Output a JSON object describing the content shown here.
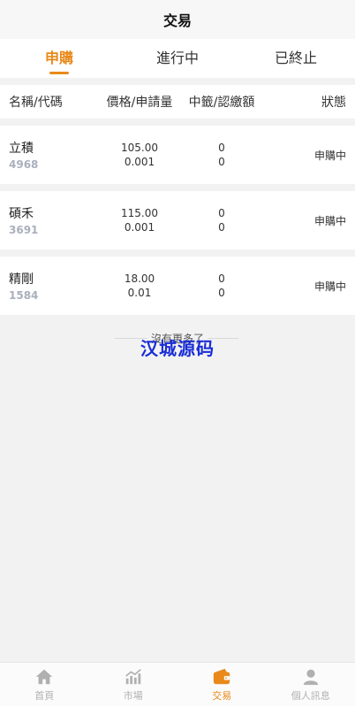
{
  "header": {
    "title": "交易"
  },
  "tabs": [
    {
      "label": "申購",
      "active": true
    },
    {
      "label": "進行中",
      "active": false
    },
    {
      "label": "已終止",
      "active": false
    }
  ],
  "columns": {
    "name": "名稱/代碼",
    "price": "價格/申請量",
    "won": "中籤/認繳額",
    "status": "狀態"
  },
  "rows": [
    {
      "name": "立積",
      "code": "4968",
      "price": "105.00",
      "qty": "0.001",
      "won": "0",
      "paid": "0",
      "status": "申購中"
    },
    {
      "name": "碩禾",
      "code": "3691",
      "price": "115.00",
      "qty": "0.001",
      "won": "0",
      "paid": "0",
      "status": "申購中"
    },
    {
      "name": "精剛",
      "code": "1584",
      "price": "18.00",
      "qty": "0.01",
      "won": "0",
      "paid": "0",
      "status": "申購中"
    }
  ],
  "footer_text": "沒有更多了",
  "watermark": "汉城源码",
  "colors": {
    "accent": "#e8891a",
    "inactive": "#b0b0b0",
    "watermark": "#1a2dd8"
  },
  "tabbar": [
    {
      "label": "首頁",
      "icon": "home-icon",
      "active": false
    },
    {
      "label": "市場",
      "icon": "chart-icon",
      "active": false
    },
    {
      "label": "交易",
      "icon": "wallet-icon",
      "active": true
    },
    {
      "label": "個人訊息",
      "icon": "user-icon",
      "active": false
    }
  ]
}
